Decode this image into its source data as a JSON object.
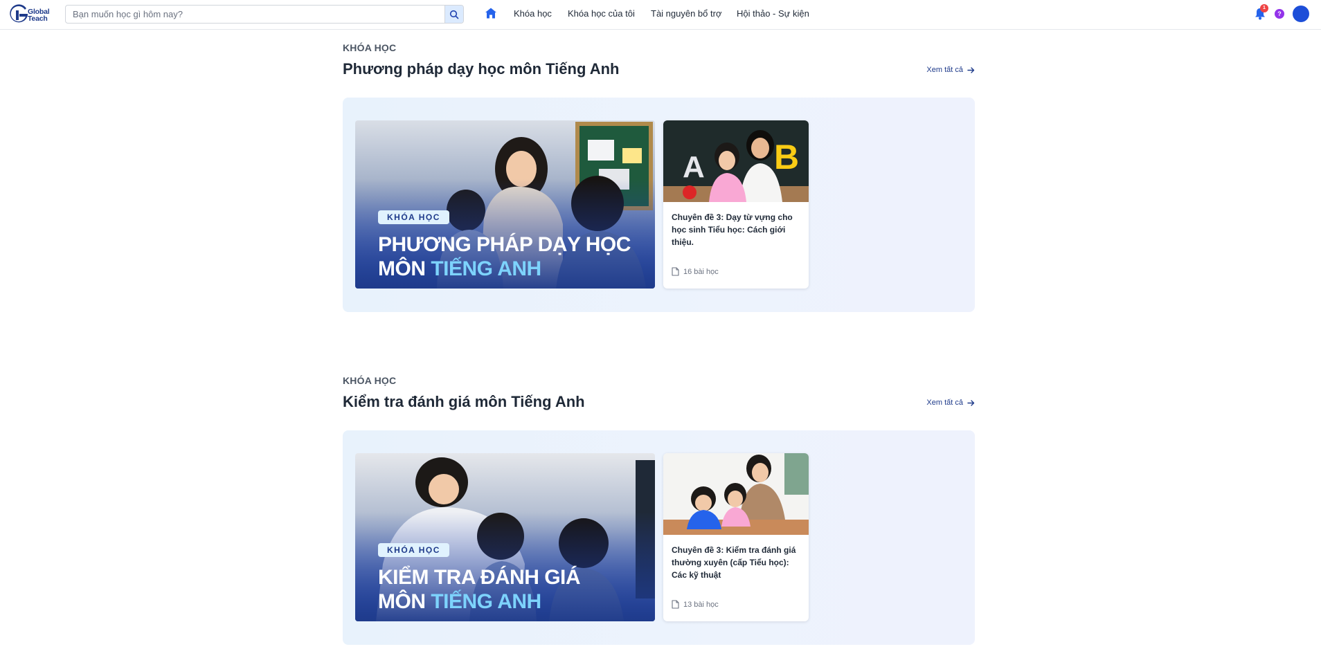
{
  "header": {
    "logo_line1": "Global",
    "logo_line2": "Teach",
    "search_placeholder": "Bạn muốn học gì hôm nay?",
    "nav": [
      "Khóa học",
      "Khóa học của tôi",
      "Tài nguyên bổ trợ",
      "Hội thảo - Sự kiện"
    ],
    "notification_count": "1",
    "help_label": "?"
  },
  "sections": [
    {
      "eyebrow": "KHÓA HỌC",
      "title": "Phương pháp dạy học môn Tiếng Anh",
      "see_all": "Xem tất cả",
      "banner": {
        "tag": "KHÓA HỌC",
        "line1": "PHƯƠNG PHÁP DẠY HỌC",
        "line2_prefix": "MÔN ",
        "line2_highlight": "TIẾNG ANH"
      },
      "card": {
        "title": "Chuyên đề 3: Dạy từ vựng cho học sinh Tiểu học: Cách giới thiệu.",
        "lessons": "16 bài học"
      }
    },
    {
      "eyebrow": "KHÓA HỌC",
      "title": "Kiểm tra đánh giá môn Tiếng Anh",
      "see_all": "Xem tất cả",
      "banner": {
        "tag": "KHÓA HỌC",
        "line1": "KIỂM TRA ĐÁNH GIÁ",
        "line2_prefix": "MÔN ",
        "line2_highlight": "TIẾNG ANH"
      },
      "card": {
        "title": "Chuyên đề 3: Kiểm tra đánh giá thường xuyên (cấp Tiểu học): Các kỹ thuật",
        "lessons": "13 bài học"
      }
    }
  ],
  "colors": {
    "brand": "#1e3a8a",
    "accent": "#2563eb",
    "highlight": "#7dd3fc",
    "badge": "#ef4444",
    "help": "#9333ea"
  }
}
